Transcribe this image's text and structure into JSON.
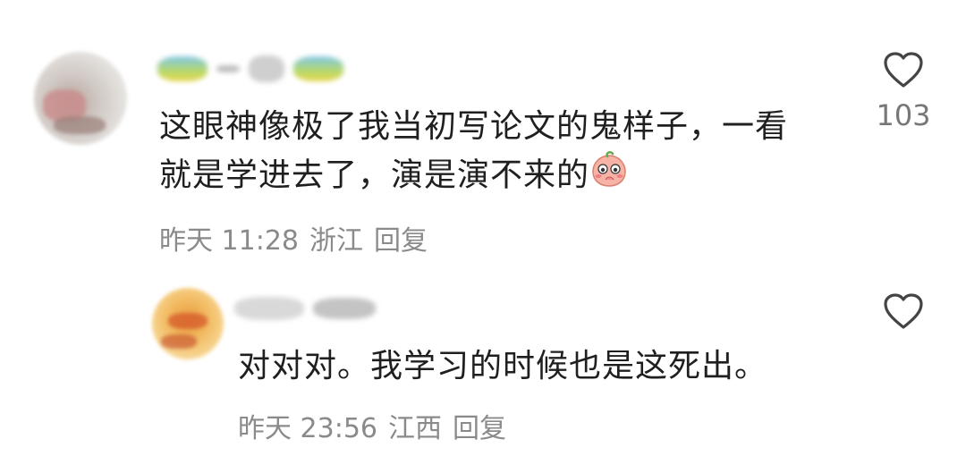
{
  "comments": [
    {
      "text_line1": "这眼神像极了我当初写论文的鬼样子，一看",
      "text_line2": "就是学进去了，演是演不来的",
      "emoji_icon": "shy-peach-emoji",
      "time": "昨天 11:28",
      "location": "浙江",
      "reply_label": "回复",
      "like_count": "103",
      "heart_icon": "heart-outline-icon"
    },
    {
      "text": "对对对。我学习的时候也是这死出。",
      "time": "昨天 23:56",
      "location": "江西",
      "reply_label": "回复",
      "heart_icon": "heart-outline-icon"
    }
  ],
  "colors": {
    "text": "#1f1f1f",
    "meta": "#8a8a8a",
    "icon": "#444444"
  }
}
